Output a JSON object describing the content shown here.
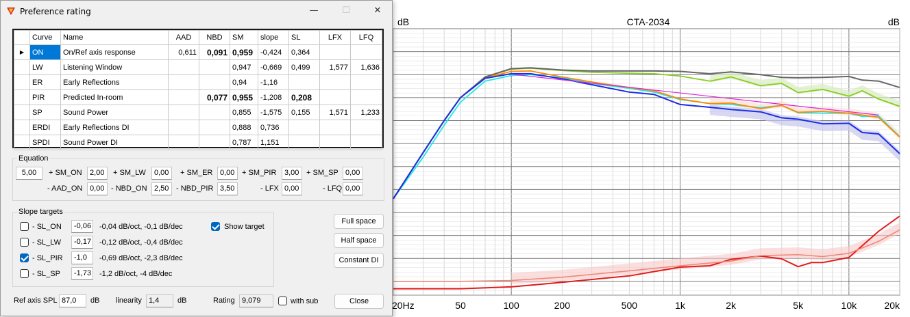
{
  "window": {
    "title": "Preference rating",
    "minimize": "—",
    "maximize": "☐",
    "close": "✕"
  },
  "table": {
    "headers": [
      "Curve",
      "Name",
      "AAD",
      "NBD",
      "SM",
      "slope",
      "SL",
      "LFX",
      "LFQ"
    ],
    "rows": [
      {
        "curve": "ON",
        "name": "On/Ref axis response",
        "aad": "0,611",
        "nbd": "0,091",
        "sm": "0,959",
        "slope": "-0,424",
        "sl": "0,364",
        "lfx": "",
        "lfq": ""
      },
      {
        "curve": "LW",
        "name": "Listening Window",
        "aad": "",
        "nbd": "",
        "sm": "0,947",
        "slope": "-0,669",
        "sl": "0,499",
        "lfx": "1,577",
        "lfq": "1,636"
      },
      {
        "curve": "ER",
        "name": "Early Reflections",
        "aad": "",
        "nbd": "",
        "sm": "0,94",
        "slope": "-1,16",
        "sl": "",
        "lfx": "",
        "lfq": ""
      },
      {
        "curve": "PIR",
        "name": "Predicted In-room",
        "aad": "",
        "nbd": "0,077",
        "sm": "0,955",
        "slope": "-1,208",
        "sl": "0,208",
        "lfx": "",
        "lfq": ""
      },
      {
        "curve": "SP",
        "name": "Sound Power",
        "aad": "",
        "nbd": "",
        "sm": "0,855",
        "slope": "-1,575",
        "sl": "0,155",
        "lfx": "1,571",
        "lfq": "1,233"
      },
      {
        "curve": "ERDI",
        "name": "Early Reflections DI",
        "aad": "",
        "nbd": "",
        "sm": "0,888",
        "slope": "0,736",
        "sl": "",
        "lfx": "",
        "lfq": ""
      },
      {
        "curve": "SPDI",
        "name": "Sound Power DI",
        "aad": "",
        "nbd": "",
        "sm": "0,787",
        "slope": "1,151",
        "sl": "",
        "lfx": "",
        "lfq": ""
      }
    ]
  },
  "equation": {
    "label": "Equation",
    "row1": [
      {
        "value": "5,00",
        "label": "+ SM_ON"
      },
      {
        "value": "2,00",
        "label": "+ SM_LW"
      },
      {
        "value": "0,00",
        "label": "+ SM_ER"
      },
      {
        "value": "0,00",
        "label": "+ SM_PIR"
      },
      {
        "value": "3,00",
        "label": "+ SM_SP"
      },
      {
        "value": "0,00",
        "label": ""
      }
    ],
    "row2": [
      {
        "label": "- AAD_ON",
        "value": "0,00"
      },
      {
        "label": "- NBD_ON",
        "value": "2,50"
      },
      {
        "label": "- NBD_PIR",
        "value": "3,50"
      },
      {
        "label": "- LFX",
        "value": "0,00"
      },
      {
        "label": "- LFQ",
        "value": "0,00"
      }
    ]
  },
  "slope": {
    "label": "Slope targets",
    "rows": [
      {
        "label": "- SL_ON",
        "value": "-0,06",
        "desc": "-0,04 dB/oct, -0,1 dB/dec",
        "checked": false
      },
      {
        "label": "- SL_LW",
        "value": "-0,17",
        "desc": "-0,12 dB/oct, -0,4 dB/dec",
        "checked": false
      },
      {
        "label": "- SL_PIR",
        "value": "-1,0",
        "desc": "-0,69 dB/oct, -2,3 dB/dec",
        "checked": true
      },
      {
        "label": "- SL_SP",
        "value": "-1,73",
        "desc": "-1,2 dB/oct, -4 dB/dec",
        "checked": false
      }
    ],
    "show_target": {
      "label": "Show target",
      "checked": true
    }
  },
  "buttons": {
    "full_space": "Full space",
    "half_space": "Half space",
    "constant_di": "Constant DI",
    "close": "Close"
  },
  "bottom": {
    "ref_label": "Ref axis SPL",
    "ref_value": "87,0",
    "ref_unit": "dB",
    "lin_label": "linearity",
    "lin_value": "1,4",
    "lin_unit": "dB",
    "rating_label": "Rating",
    "rating_value": "9,079",
    "with_sub_label": "with sub",
    "with_sub_checked": false
  },
  "chart_data": {
    "type": "line",
    "title": "CTA-2034",
    "ylabel_left": "dB",
    "ylabel_right": "dB",
    "x_scale": "log",
    "xlim": [
      20,
      20000
    ],
    "x_ticks": [
      {
        "v": 20,
        "label": "20Hz"
      },
      {
        "v": 50,
        "label": "50"
      },
      {
        "v": 100,
        "label": "100"
      },
      {
        "v": 200,
        "label": "200"
      },
      {
        "v": 500,
        "label": "500"
      },
      {
        "v": 1000,
        "label": "1k"
      },
      {
        "v": 2000,
        "label": "2k"
      },
      {
        "v": 5000,
        "label": "5k"
      },
      {
        "v": 10000,
        "label": "10k"
      },
      {
        "v": 20000,
        "label": "20k"
      }
    ],
    "grid": true,
    "colors": {
      "on": "#666666",
      "lw": "#88cc22",
      "er": "#ff8800",
      "pir": "#1a2fe0",
      "sp": "#22e6e6",
      "target": "#e020e0",
      "erdi": "#ee8877",
      "spdi": "#e21a1a",
      "lw_band": "#d8ecc0",
      "pir_band": "#c8c8f0",
      "er_band": "#f8dccc",
      "di_band": "#f8c8c8"
    },
    "series": [
      {
        "key": "on",
        "x": [
          20,
          30,
          40,
          50,
          70,
          100,
          130,
          200,
          300,
          500,
          700,
          1000,
          1500,
          2000,
          3000,
          4000,
          5000,
          7000,
          10000,
          12000,
          15000,
          20000
        ],
        "y": [
          -22,
          -12,
          -5,
          0,
          4.5,
          6.3,
          6.5,
          6,
          5.8,
          5.8,
          5.8,
          5.7,
          5.2,
          5.6,
          5,
          4.4,
          4.3,
          4.4,
          4.6,
          3.8,
          3.6,
          2.2
        ]
      },
      {
        "key": "lw",
        "x": [
          20,
          30,
          40,
          50,
          70,
          100,
          130,
          200,
          300,
          500,
          700,
          1000,
          1500,
          2000,
          3000,
          4000,
          5000,
          7000,
          10000,
          12000,
          15000,
          20000
        ],
        "y": [
          -22,
          -12,
          -5,
          0,
          4.5,
          6.2,
          6.4,
          5.9,
          5.5,
          5.3,
          5.2,
          4.7,
          3.6,
          4.5,
          2.6,
          3.1,
          1.1,
          1.8,
          0.3,
          1.5,
          -0.3,
          -1.9
        ]
      },
      {
        "key": "er",
        "x": [
          20,
          30,
          40,
          50,
          70,
          100,
          130,
          200,
          300,
          500,
          700,
          1000,
          1500,
          2000,
          3000,
          4000,
          5000,
          7000,
          10000,
          12000,
          15000,
          20000
        ],
        "y": [
          -22,
          -12,
          -5,
          0,
          4.3,
          5.7,
          5.8,
          4.5,
          3.4,
          2.2,
          1.5,
          -0.3,
          -1.3,
          -1.2,
          -2.4,
          -1.7,
          -3.2,
          -3,
          -3.4,
          -3.8,
          -4.3,
          -8.6
        ]
      },
      {
        "key": "pir",
        "x": [
          20,
          30,
          40,
          50,
          70,
          100,
          130,
          200,
          300,
          500,
          700,
          1000,
          1500,
          2000,
          3000,
          4000,
          5000,
          7000,
          10000,
          12000,
          15000,
          20000
        ],
        "y": [
          -22,
          -12,
          -5,
          0,
          4.2,
          5.2,
          5.2,
          4.1,
          2.8,
          1.2,
          0.7,
          -1.5,
          -2.1,
          -2.6,
          -3.1,
          -4.4,
          -4.7,
          -5.7,
          -5.6,
          -7.6,
          -7.9,
          -12.2
        ]
      },
      {
        "key": "sp",
        "x": [
          20,
          30,
          40,
          50,
          70,
          100,
          130,
          200,
          300,
          500,
          700,
          1000,
          1500,
          2000,
          3000,
          4000,
          5000,
          7000,
          10000,
          12000,
          15000,
          20000
        ],
        "y": [
          -22,
          -13,
          -6,
          -1,
          3.6,
          4.8,
          5,
          4.3,
          3.1,
          2,
          1.2,
          -0.4,
          -1.3,
          -1.5,
          -2.2,
          -1.7,
          -3.3,
          -3.4,
          -3.4,
          -4.1,
          -4,
          -8.5
        ]
      },
      {
        "key": "target",
        "x": [
          100,
          15000
        ],
        "y": [
          5.1,
          -3.8
        ]
      },
      {
        "key": "erdi",
        "x": [
          20,
          30,
          50,
          100,
          200,
          500,
          1000,
          2000,
          3000,
          5000,
          7000,
          10000,
          15000,
          20000
        ],
        "y": [
          -40,
          -40,
          -40,
          -39.8,
          -39.1,
          -37.7,
          -36.6,
          -35.6,
          -34.4,
          -34.2,
          -34.6,
          -33.9,
          -31.3,
          -28.8
        ]
      },
      {
        "key": "spdi",
        "x": [
          20,
          30,
          50,
          100,
          200,
          500,
          1000,
          1500,
          2000,
          3000,
          4000,
          5000,
          6000,
          7000,
          10000,
          15000,
          20000
        ],
        "y": [
          -41.6,
          -41.6,
          -41.6,
          -41.2,
          -40.2,
          -38.8,
          -36.9,
          -36.6,
          -35.2,
          -34.5,
          -35.1,
          -36.8,
          -35.9,
          -35.9,
          -34.8,
          -29.1,
          -25.8
        ]
      }
    ]
  }
}
